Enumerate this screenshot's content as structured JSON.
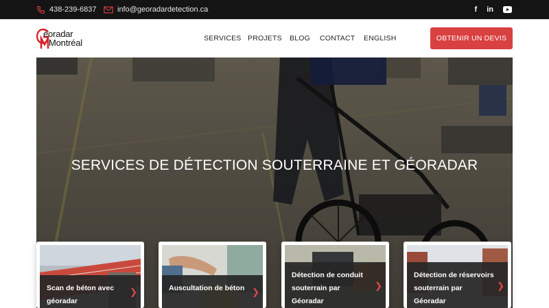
{
  "topbar": {
    "phone": "438-239-6837",
    "email": "info@georadardetection.ca",
    "socials": [
      {
        "icon": "facebook-icon",
        "glyph": "f"
      },
      {
        "icon": "linkedin-icon",
        "glyph": "in"
      },
      {
        "icon": "youtube-icon",
        "glyph": "▶"
      }
    ]
  },
  "logo": {
    "line1": "éoradar",
    "line2": "Montréal",
    "brand_color": "#d9222a"
  },
  "nav": {
    "items": [
      "SERVICES",
      "PROJETS",
      "BLOG",
      "CONTACT",
      "ENGLISH"
    ],
    "cta": "OBTENIR UN DEVIS"
  },
  "hero": {
    "title": "SERVICES DE DÉTECTION SOUTERRAINE ET GÉORADAR"
  },
  "cards": [
    {
      "label": "Scan de béton avec géoradar"
    },
    {
      "label": "Auscultation de béton"
    },
    {
      "label": "Détection de conduit souterrain par Géoradar"
    },
    {
      "label": "Détection de réservoirs souterrain par Géoradar"
    }
  ],
  "colors": {
    "accent": "#d94040",
    "topbar": "#141414"
  }
}
